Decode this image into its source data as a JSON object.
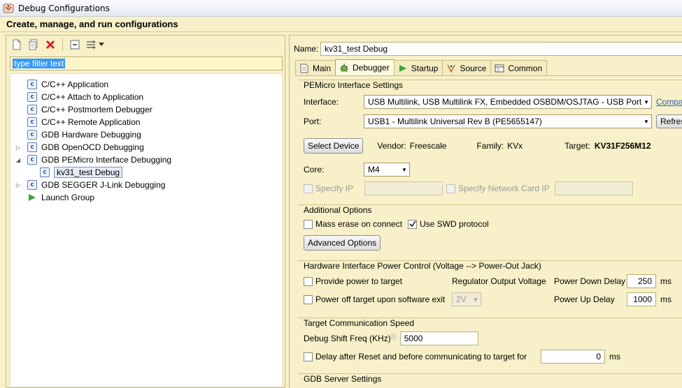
{
  "window": {
    "title": "Debug Configurations"
  },
  "header": {
    "title": "Create, manage, and run configurations"
  },
  "left": {
    "filter_placeholder": "type filter text",
    "tree": [
      {
        "label": "C/C++ Application",
        "icon": "c-config-icon",
        "indent": 0,
        "twisty": ""
      },
      {
        "label": "C/C++ Attach to Application",
        "icon": "c-config-icon",
        "indent": 0,
        "twisty": ""
      },
      {
        "label": "C/C++ Postmortem Debugger",
        "icon": "c-config-icon",
        "indent": 0,
        "twisty": ""
      },
      {
        "label": "C/C++ Remote Application",
        "icon": "c-config-icon",
        "indent": 0,
        "twisty": ""
      },
      {
        "label": "GDB Hardware Debugging",
        "icon": "c-config-icon",
        "indent": 0,
        "twisty": ""
      },
      {
        "label": "GDB OpenOCD Debugging",
        "icon": "c-config-icon",
        "indent": 0,
        "twisty": "collapsed"
      },
      {
        "label": "GDB PEMicro Interface Debugging",
        "icon": "c-config-icon",
        "indent": 0,
        "twisty": "expanded"
      },
      {
        "label": "kv31_test Debug",
        "icon": "c-config-icon",
        "indent": 1,
        "twisty": "",
        "selected": true
      },
      {
        "label": "GDB SEGGER J-Link Debugging",
        "icon": "c-config-icon",
        "indent": 0,
        "twisty": "collapsed"
      },
      {
        "label": "Launch Group",
        "icon": "launch-group-icon",
        "indent": 0,
        "twisty": ""
      }
    ]
  },
  "right": {
    "name_label": "Name:",
    "name_value": "kv31_test Debug",
    "tabs": [
      {
        "label": "Main",
        "icon": "main-tab-icon"
      },
      {
        "label": "Debugger",
        "icon": "debugger-tab-icon",
        "active": true
      },
      {
        "label": "Startup",
        "icon": "startup-tab-icon"
      },
      {
        "label": "Source",
        "icon": "source-tab-icon"
      },
      {
        "label": "Common",
        "icon": "common-tab-icon"
      }
    ],
    "pemicro": {
      "title": "PEMicro Interface Settings",
      "interface_label": "Interface:",
      "interface_value": "USB Multilink, USB Multilink FX, Embedded OSBDM/OSJTAG - USB Port",
      "compat_link": "Compat",
      "port_label": "Port:",
      "port_value": "USB1 - Multilink Universal Rev B (PE5655147)",
      "refresh_label": "Refresh",
      "select_device_label": "Select Device",
      "vendor_label": "Vendor:",
      "vendor_value": "Freescale",
      "family_label": "Family:",
      "family_value": "KVx",
      "target_label": "Target:",
      "target_value": "KV31F256M12",
      "core_label": "Core:",
      "core_value": "M4",
      "specify_ip_label": "Specify IP",
      "specify_card_label": "Specify Network Card IP"
    },
    "additional": {
      "title": "Additional Options",
      "mass_erase_label": "Mass erase on connect",
      "swd_label": "Use SWD protocol",
      "advanced_label": "Advanced Options"
    },
    "power": {
      "title": "Hardware Interface Power Control (Voltage --> Power-Out Jack)",
      "provide_label": "Provide power to target",
      "regulator_label": "Regulator Output Voltage",
      "down_label": "Power Down Delay",
      "down_value": "250",
      "down_unit": "ms",
      "poweroff_label": "Power off target upon software exit",
      "voltage_value": "2V",
      "up_label": "Power Up Delay",
      "up_value": "1000",
      "up_unit": "ms"
    },
    "speed": {
      "title": "Target Communication Speed",
      "freq_label": "Debug Shift Freq (KHz)",
      "freq_value": "5000",
      "delay_label": "Delay after Reset and before communicating to target for",
      "delay_value": "0",
      "delay_unit": "ms"
    },
    "gdb": {
      "title": "GDB Server Settings"
    }
  }
}
